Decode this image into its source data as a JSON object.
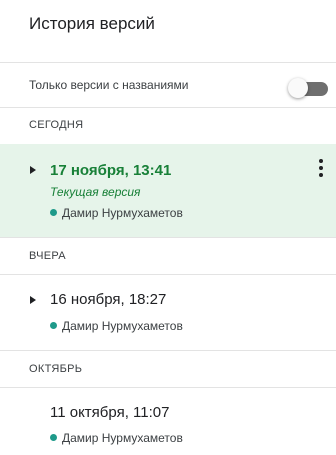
{
  "header": {
    "title": "История версий"
  },
  "filter": {
    "label": "Только версии с названиями",
    "toggle_on": false
  },
  "sections": [
    {
      "label": "СЕГОДНЯ",
      "entries": [
        {
          "date": "17 ноября, 13:41",
          "subtitle": "Текущая версия",
          "author": "Дамир Нурмухаметов",
          "current": true,
          "expandable": true
        }
      ]
    },
    {
      "label": "ВЧЕРА",
      "entries": [
        {
          "date": "16 ноября, 18:27",
          "author": "Дамир Нурмухаметов",
          "current": false,
          "expandable": true
        }
      ]
    },
    {
      "label": "ОКТЯБРЬ",
      "entries": [
        {
          "date": "11 октября, 11:07",
          "author": "Дамир Нурмухаметов",
          "current": false,
          "expandable": false
        }
      ]
    }
  ],
  "colors": {
    "current_bg": "#e6f4ea",
    "current_text": "#188038",
    "author_dot": "#1e9a8a"
  },
  "icons": {
    "expand": "triangle-right-icon",
    "more": "more-vert-icon",
    "author": "color-dot-icon"
  }
}
